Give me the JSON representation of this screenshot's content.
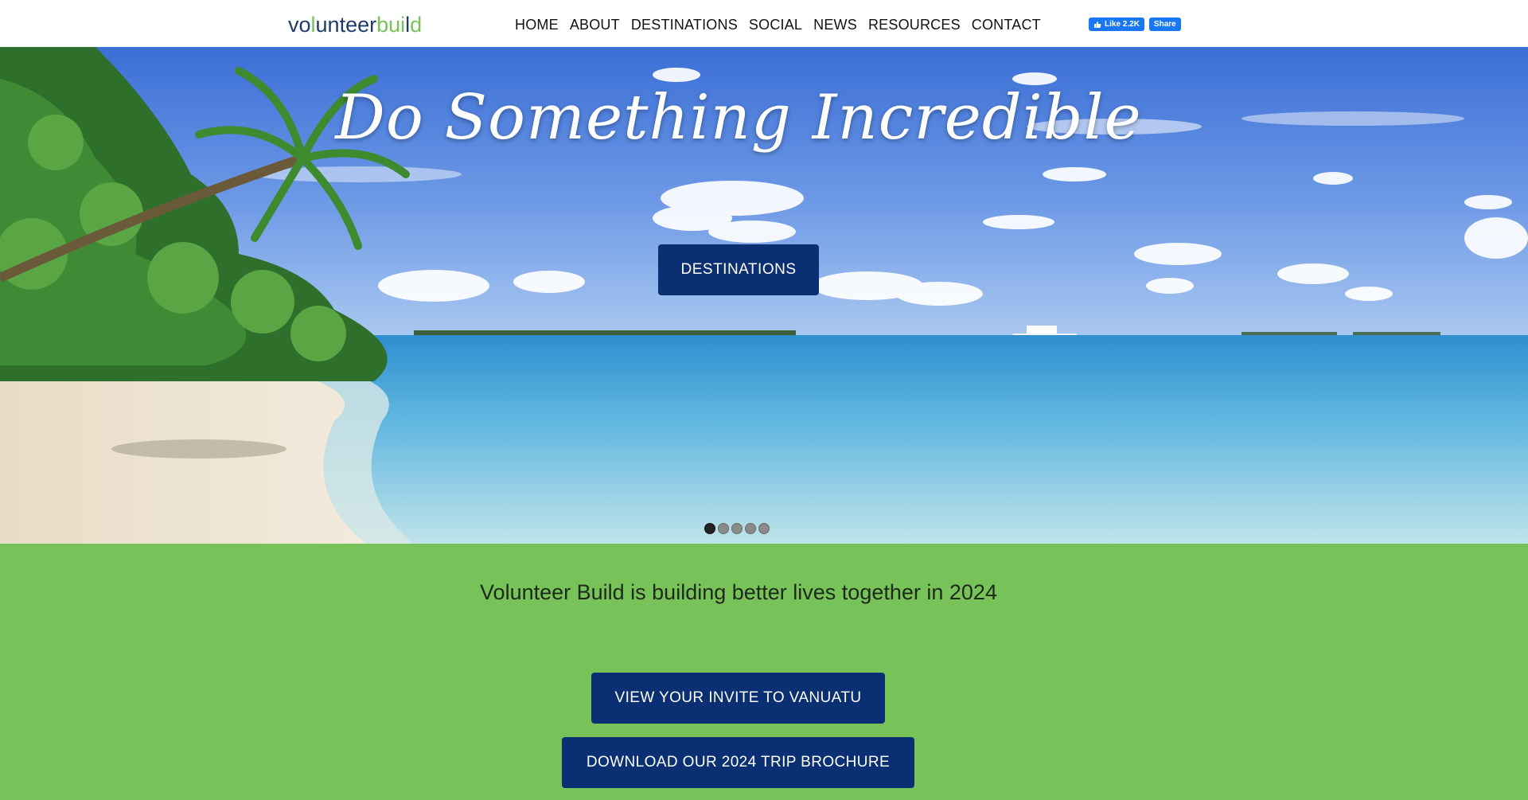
{
  "logo": {
    "text_left": "vo",
    "text_mid": "unteer",
    "text_right": "bui",
    "text_end": "d",
    "accent": "#78c25a",
    "primary": "#1f3b6e"
  },
  "nav": {
    "items": [
      "HOME",
      "ABOUT",
      "DESTINATIONS",
      "SOCIAL",
      "NEWS",
      "RESOURCES",
      "CONTACT"
    ]
  },
  "facebook": {
    "like_label": "Like 2.2K",
    "share_label": "Share",
    "color": "#1877f2"
  },
  "hero": {
    "title": "Do Something Incredible",
    "button_label": "DESTINATIONS",
    "slide_count": 5,
    "active_slide": 1
  },
  "intro": {
    "tagline": "Volunteer Build is building better lives together in 2024",
    "cta_primary": "VIEW YOUR INVITE TO VANUATU",
    "cta_secondary": "DOWNLOAD OUR 2024 TRIP BROCHURE"
  },
  "colors": {
    "button_bg": "#0b2f73",
    "section_green": "#78c25a"
  }
}
